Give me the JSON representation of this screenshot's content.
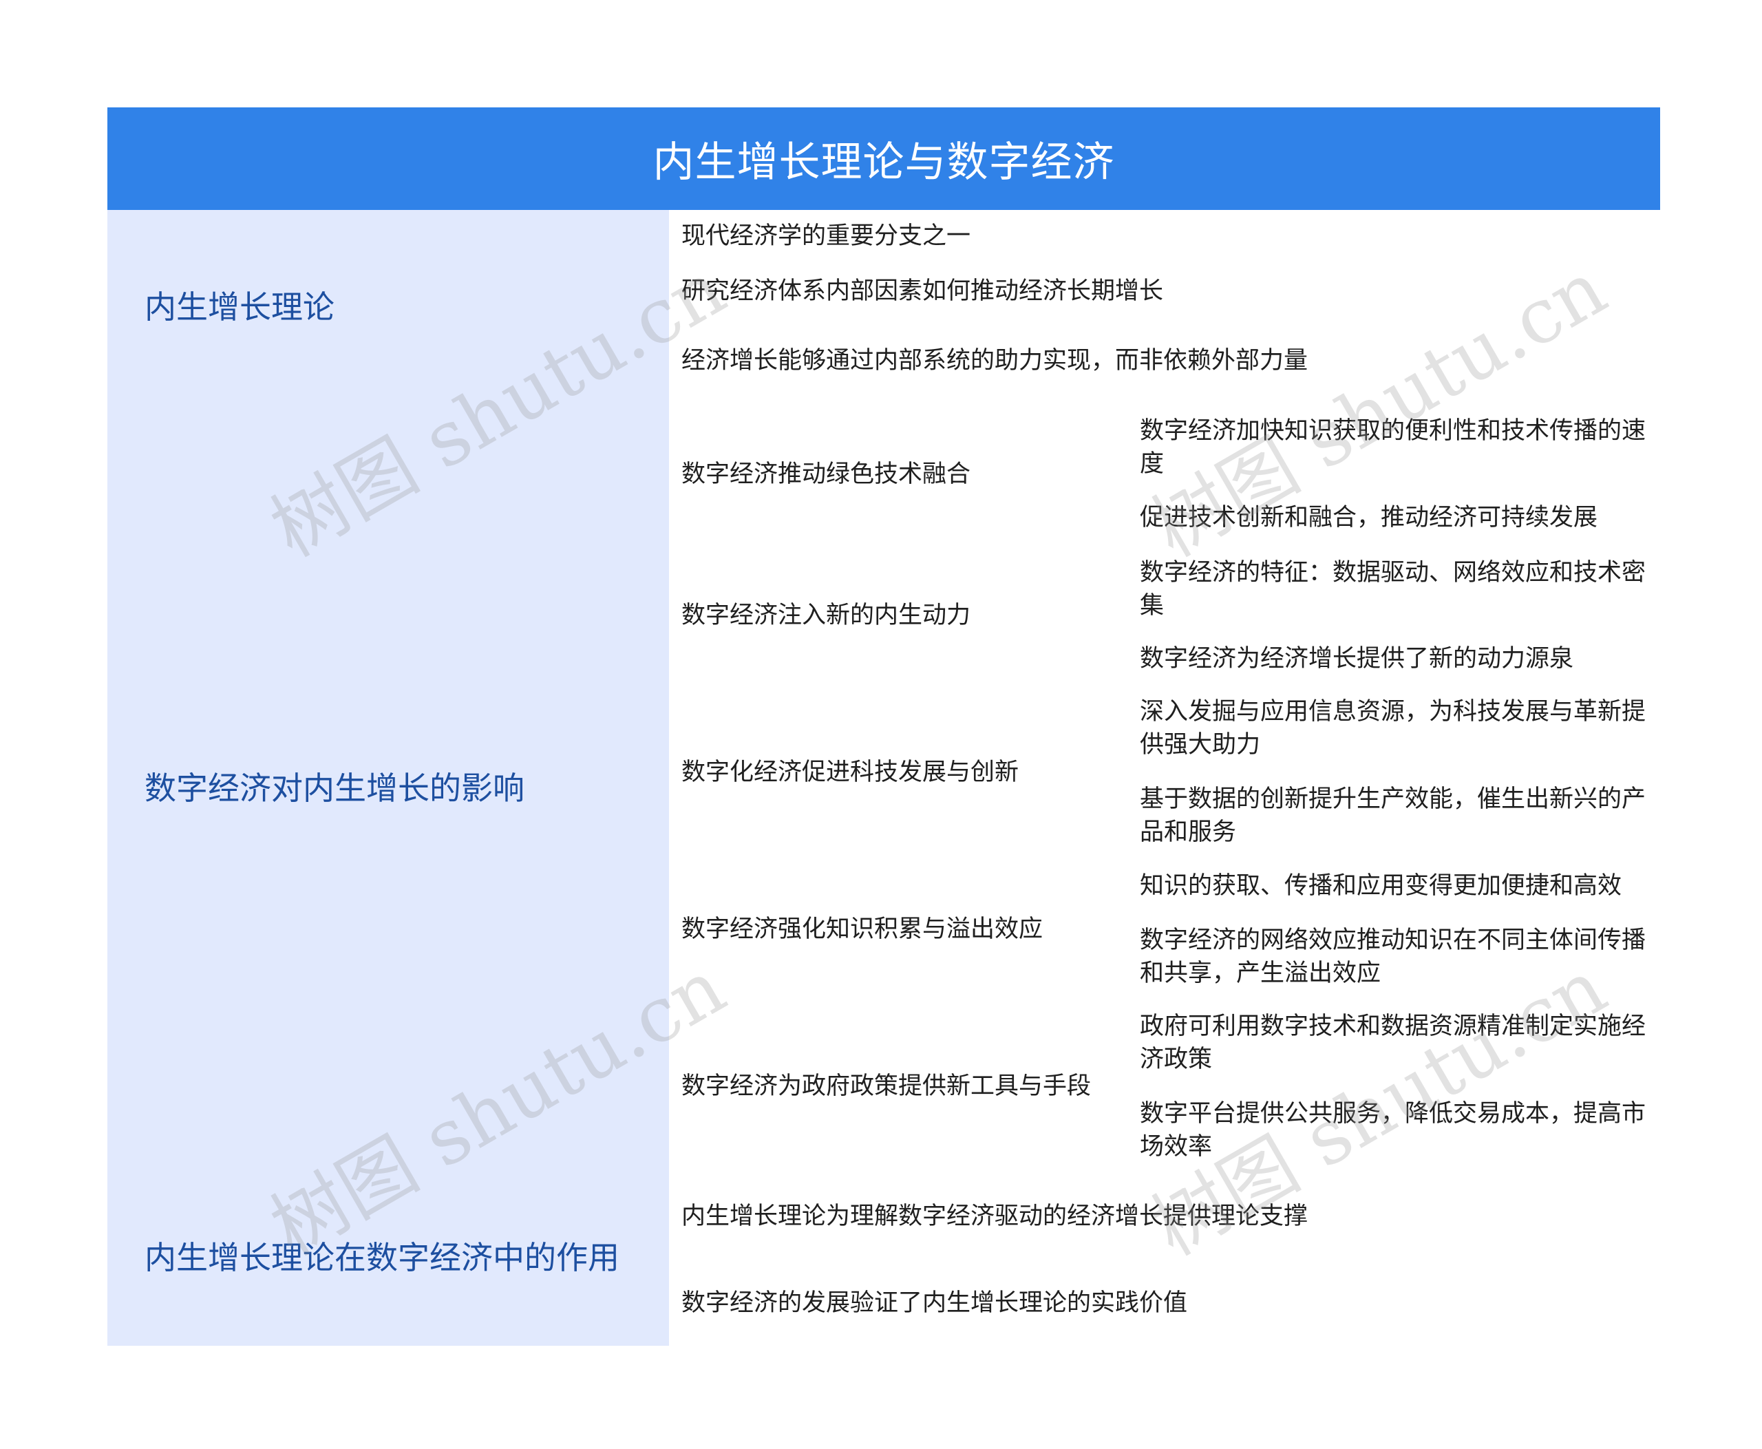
{
  "title": "内生增长理论与数字经济",
  "watermark": "树图 shutu.cn",
  "sections": [
    {
      "label": "内生增长理论",
      "items": [
        {
          "text": "现代经济学的重要分支之一"
        },
        {
          "text": "研究经济体系内部因素如何推动经济长期增长"
        },
        {
          "text": "经济增长能够通过内部系统的助力实现，而非依赖外部力量"
        }
      ]
    },
    {
      "label": "数字经济对内生增长的影响",
      "items": [
        {
          "text": "数字经济推动绿色技术融合",
          "children": [
            "数字经济加快知识获取的便利性和技术传播的速度",
            "促进技术创新和融合，推动经济可持续发展"
          ]
        },
        {
          "text": "数字经济注入新的内生动力",
          "children": [
            "数字经济的特征：数据驱动、网络效应和技术密集",
            "数字经济为经济增长提供了新的动力源泉"
          ]
        },
        {
          "text": "数字化经济促进科技发展与创新",
          "children": [
            "深入发掘与应用信息资源，为科技发展与革新提供强大助力",
            "基于数据的创新提升生产效能，催生出新兴的产品和服务"
          ]
        },
        {
          "text": "数字经济强化知识积累与溢出效应",
          "children": [
            "知识的获取、传播和应用变得更加便捷和高效",
            "数字经济的网络效应推动知识在不同主体间传播和共享，产生溢出效应"
          ]
        },
        {
          "text": "数字经济为政府政策提供新工具与手段",
          "children": [
            "政府可利用数字技术和数据资源精准制定实施经济政策",
            "数字平台提供公共服务，降低交易成本，提高市场效率"
          ]
        }
      ]
    },
    {
      "label": "内生增长理论在数字经济中的作用",
      "items": [
        {
          "text": "内生增长理论为理解数字经济驱动的经济增长提供理论支撑"
        },
        {
          "text": "数字经济的发展验证了内生增长理论的实践价值"
        }
      ]
    }
  ]
}
